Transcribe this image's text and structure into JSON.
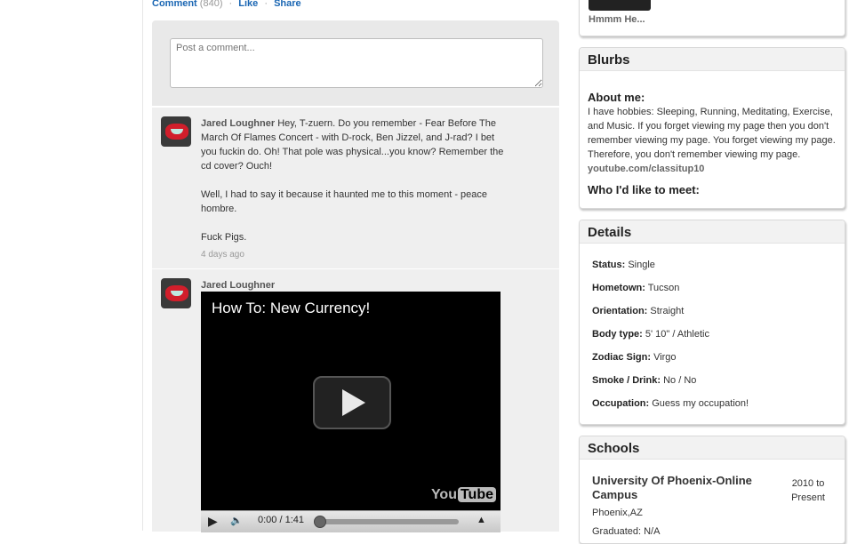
{
  "actions": {
    "comment_label": "Comment",
    "comment_count": "(840)",
    "like_label": "Like",
    "share_label": "Share",
    "separator": "·"
  },
  "comment_box": {
    "placeholder": "Post a comment..."
  },
  "comments": [
    {
      "author": "Jared Loughner",
      "paragraphs": [
        "Hey, T-zuern. Do you remember - Fear Before The March Of Flames Concert - with D-rock, Ben Jizzel, and J-rad? I bet you fuckin do. Oh! That pole was physical...you know? Remember the cd cover? Ouch!",
        "Well, I had to say it because it haunted me to this moment - peace hombre.",
        "Fuck Pigs."
      ],
      "time": "4 days ago"
    },
    {
      "author": "Jared Loughner",
      "video": {
        "title": "How To: New Currency!",
        "logo_you": "You",
        "logo_tube": "Tube",
        "time": "0:00 / 1:41",
        "progress": 0
      }
    }
  ],
  "sidebar": {
    "top_caption": "Hmmm He...",
    "blurbs": {
      "title": "Blurbs",
      "about_label": "About me:",
      "about_text": "I have hobbies: Sleeping, Running, Meditating, Exercise, and Music. If you forget viewing my page then you don't remember viewing my page. You forget viewing my page. Therefore, you don't remember viewing my page.",
      "link": "youtube.com/classitup10",
      "meet_label": "Who I'd like to meet:"
    },
    "details": {
      "title": "Details",
      "rows": [
        {
          "label": "Status:",
          "value": "Single"
        },
        {
          "label": "Hometown:",
          "value": "Tucson"
        },
        {
          "label": "Orientation:",
          "value": "Straight"
        },
        {
          "label": "Body type:",
          "value": "5' 10\" / Athletic"
        },
        {
          "label": "Zodiac Sign:",
          "value": "Virgo"
        },
        {
          "label": "Smoke / Drink:",
          "value": "No / No"
        },
        {
          "label": "Occupation:",
          "value": "Guess my occupation!"
        }
      ]
    },
    "schools": {
      "title": "Schools",
      "name": "University Of Phoenix-Online Campus",
      "years_top": "2010 to",
      "years_bottom": "Present",
      "location": "Phoenix,AZ",
      "graduated": "Graduated: N/A"
    }
  }
}
